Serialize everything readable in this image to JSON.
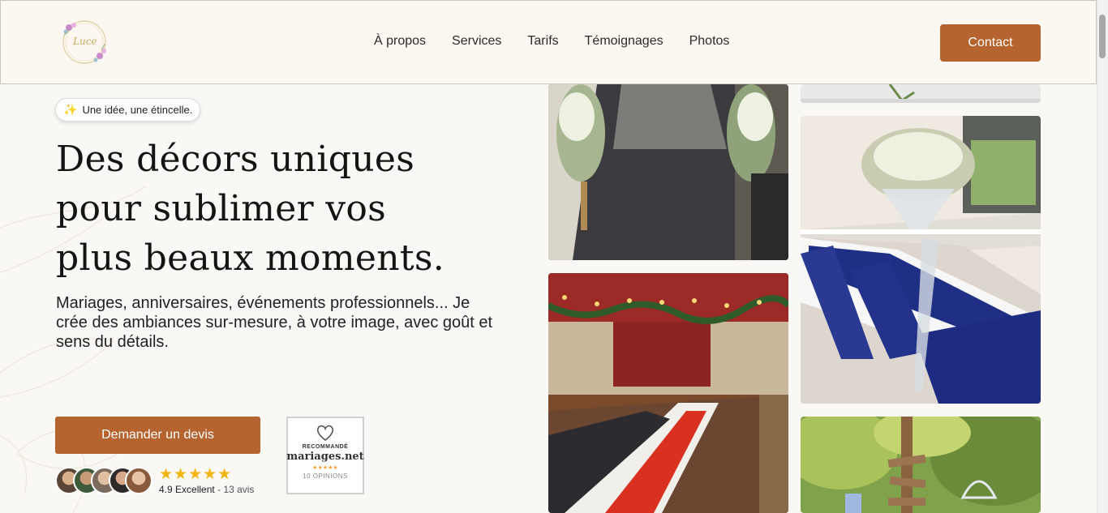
{
  "header": {
    "logo_text": "Luce",
    "nav": [
      "À propos",
      "Services",
      "Tarifs",
      "Témoignages",
      "Photos"
    ],
    "contact_label": "Contact"
  },
  "hero": {
    "badge_icon": "sparkle-icon",
    "badge_text": "Une idée, une étincelle.",
    "headline_lines": [
      "Des décors uniques",
      "pour sublimer vos",
      "plus beaux moments."
    ],
    "subtitle": "Mariages, anniversaires, événements professionnels... Je crée des ambiances sur-mesure, à votre image, avec goût et sens du détails.",
    "cta_label": "Demander un devis",
    "stars": "★★★★★",
    "rating_value": "4.9 Excellent",
    "rating_count": "- 13 avis",
    "badge_mariages": {
      "recommended": "RECOMMANDÉ",
      "brand": "mariages.net",
      "stars": "★★★★★",
      "opinions": "10 OPINIONS"
    }
  },
  "gallery": {
    "photos": [
      "photo-wedding-entrance-flowers",
      "photo-table-top-partial",
      "photo-blue-white-banquet",
      "photo-red-hall-banquet",
      "photo-garden-signpost"
    ]
  },
  "colors": {
    "accent": "#b5632f",
    "header_bg": "#fcf8f1",
    "page_bg": "#faf8f4",
    "star": "#f2b40d"
  }
}
